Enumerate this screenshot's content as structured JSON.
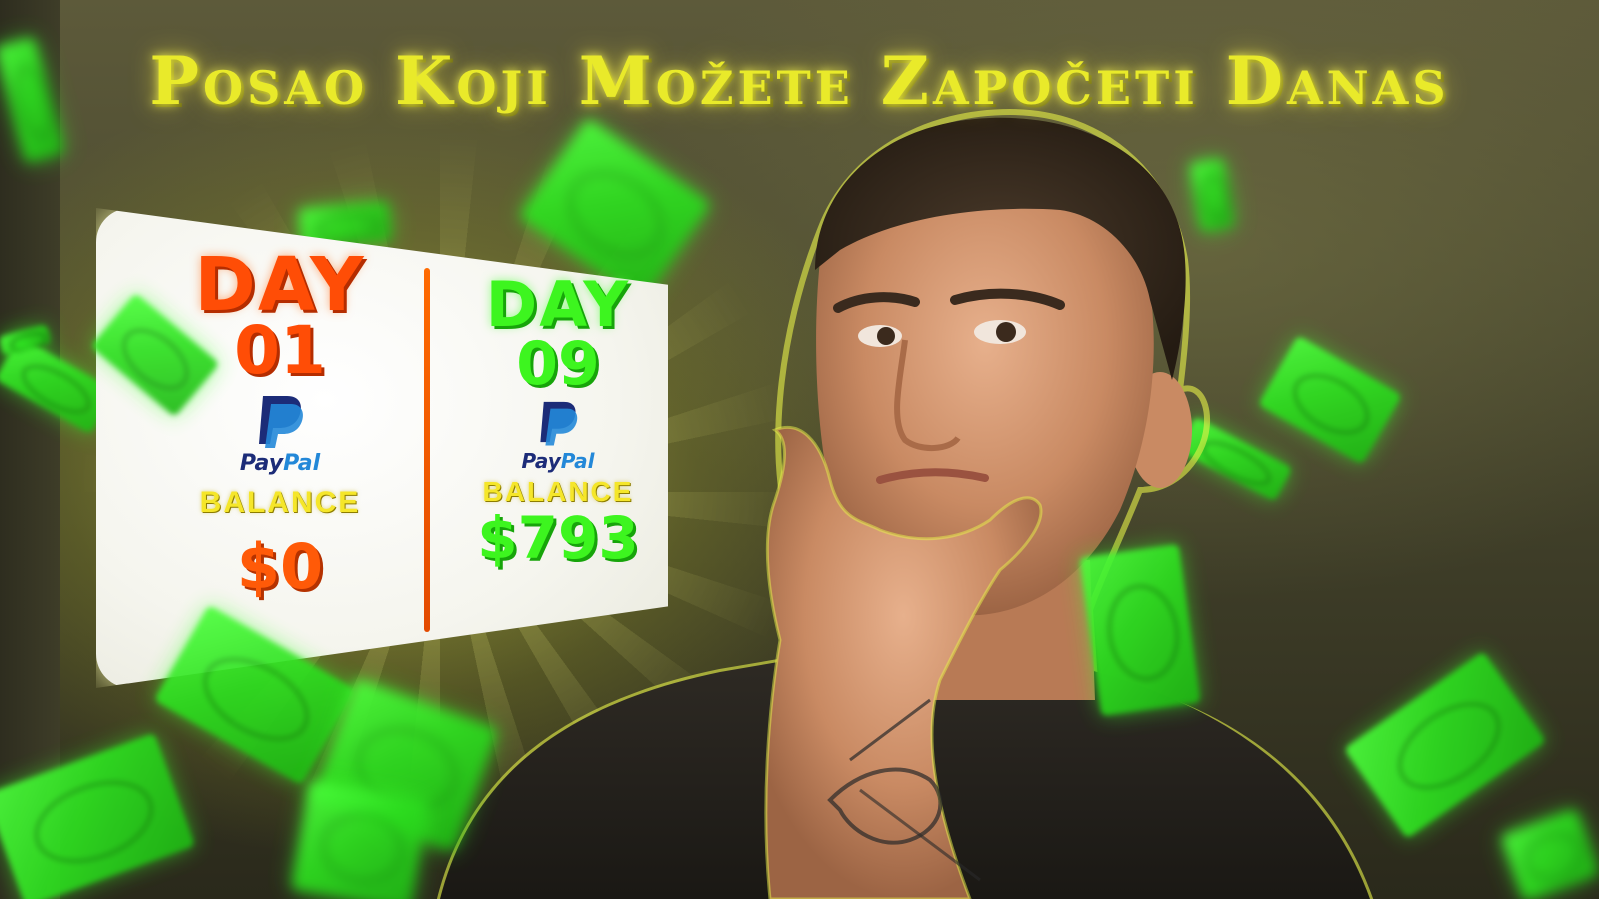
{
  "thumbnail": {
    "title": "Posao Koji Možete Započeti Danas",
    "card": {
      "left": {
        "day_label": "DAY",
        "day_number": "01",
        "paypal_pay": "Pay",
        "paypal_pal": "Pal",
        "balance_label": "BALANCE",
        "amount": "$0"
      },
      "right": {
        "day_label": "DAY",
        "day_number": "09",
        "paypal_pay": "Pay",
        "paypal_pal": "Pal",
        "balance_label": "BALANCE",
        "amount": "$793"
      }
    },
    "colors": {
      "title": "#e9ea2a",
      "day01": "#ff4d06",
      "day09": "#3df51f",
      "balance": "#f5e62a",
      "money": "#2ee020"
    }
  }
}
